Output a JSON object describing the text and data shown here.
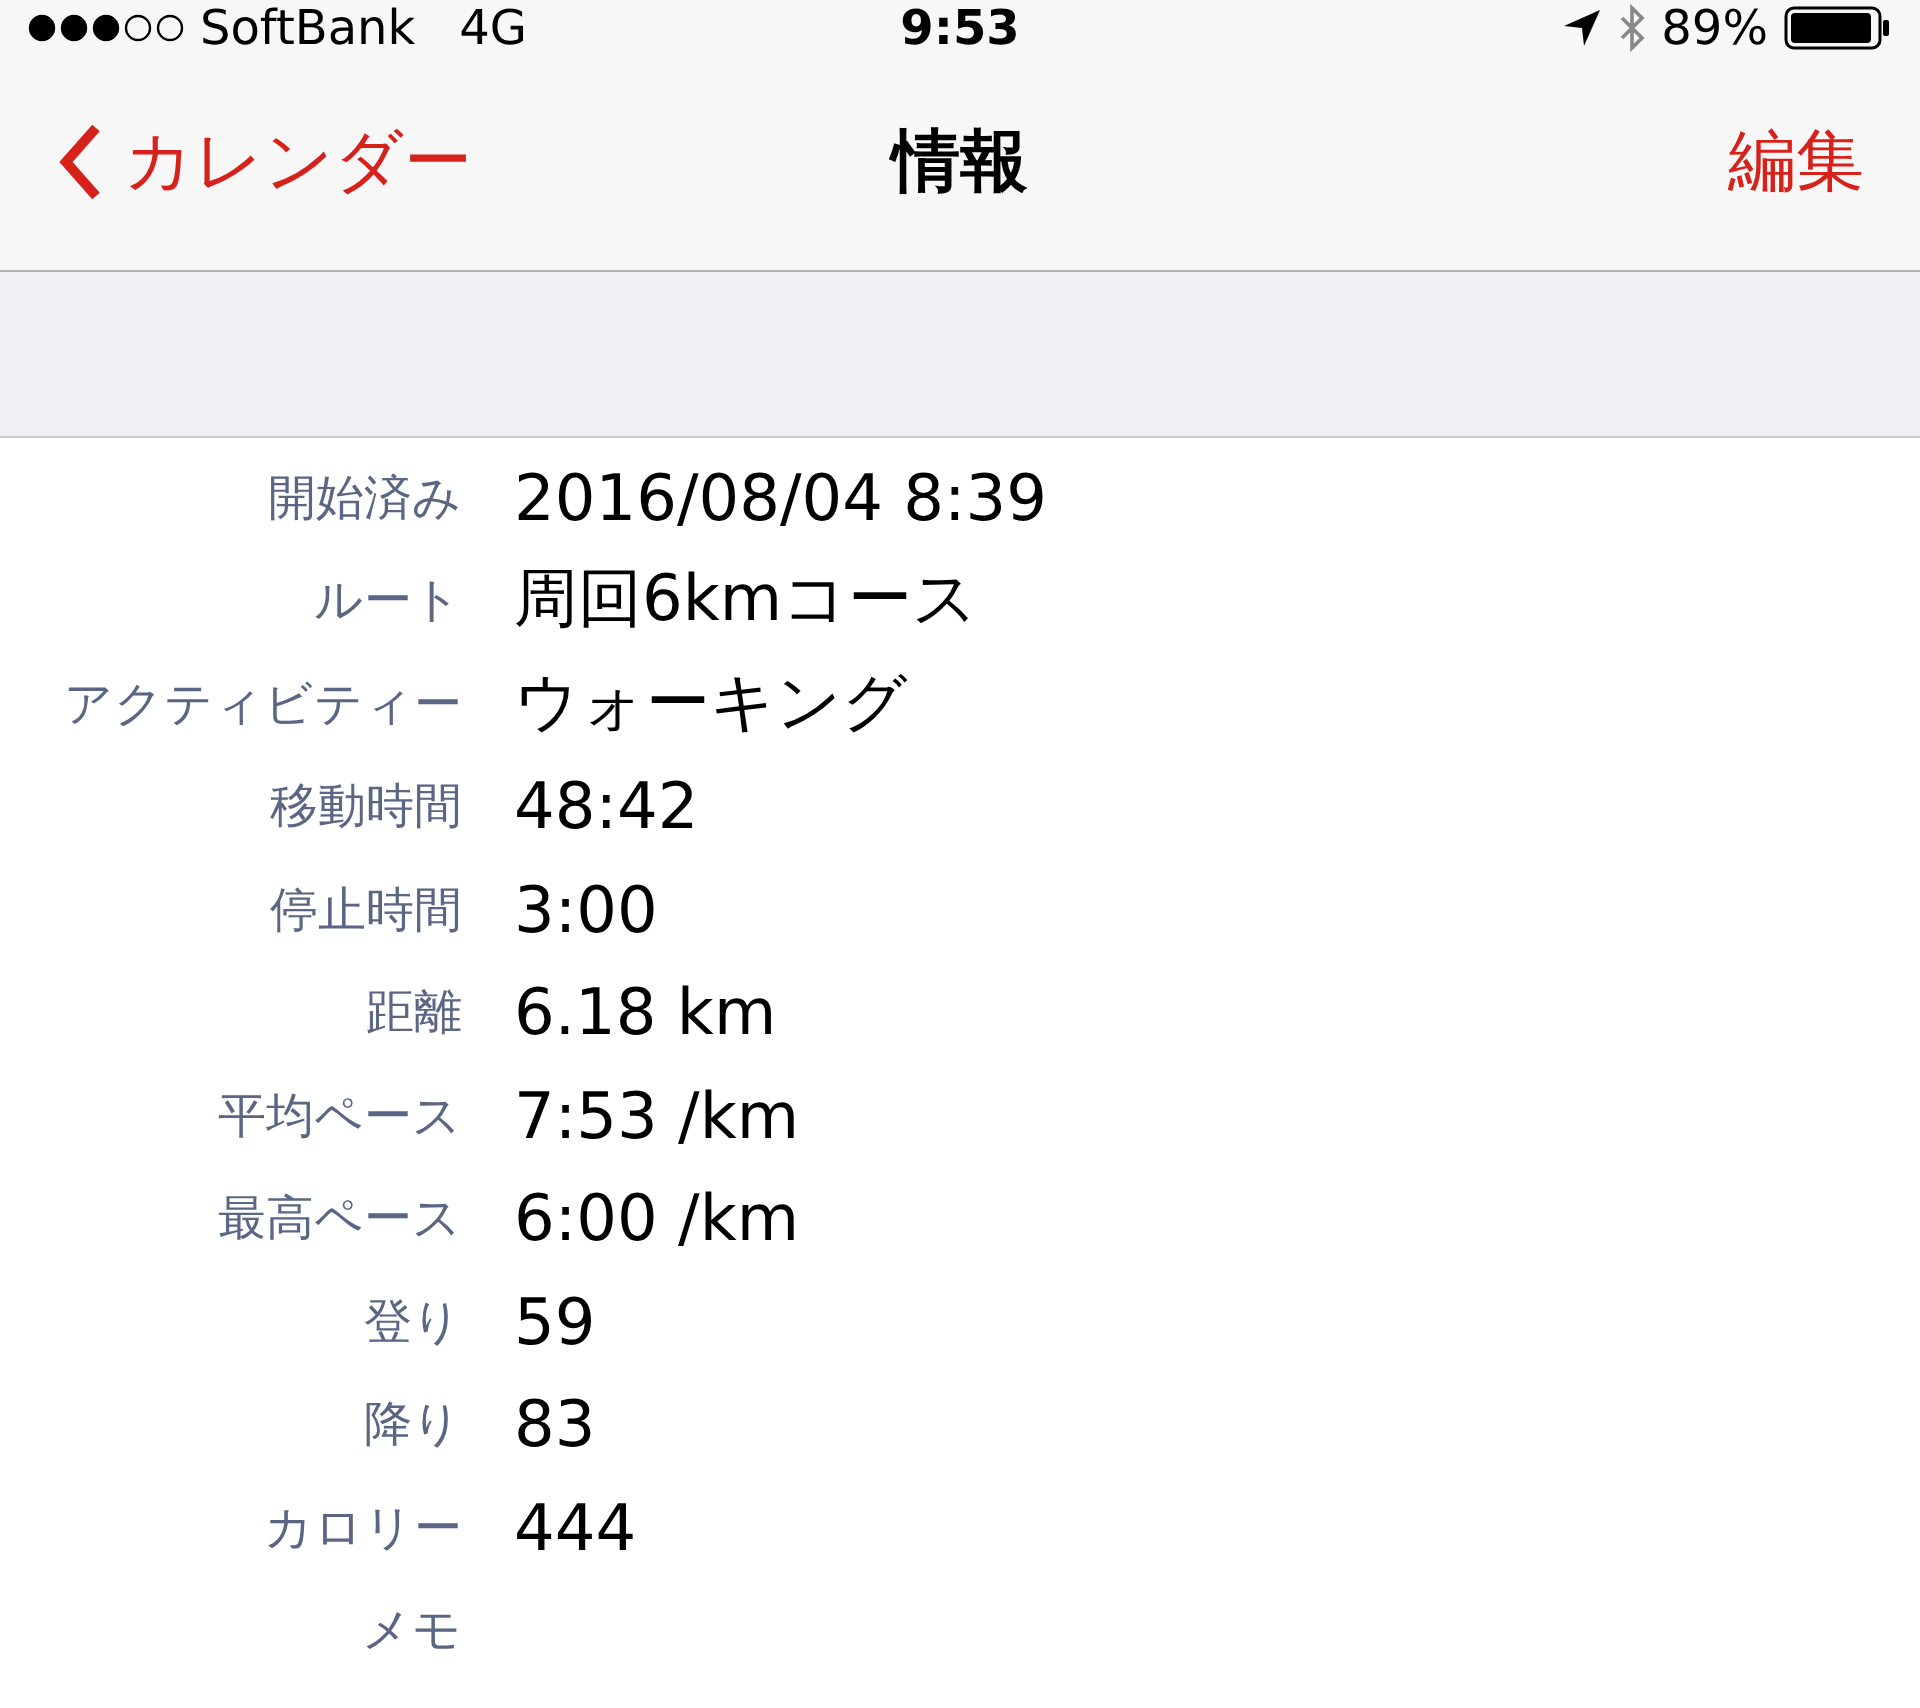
{
  "status_bar": {
    "carrier": "SoftBank",
    "network": "4G",
    "time": "9:53",
    "battery": "89%"
  },
  "nav_bar": {
    "back_label": "カレンダー",
    "title": "情報",
    "action": "編集"
  },
  "rows": [
    {
      "label": "開始済み",
      "value": "2016/08/04 8:39"
    },
    {
      "label": "ルート",
      "value": "周回6kmコース"
    },
    {
      "label": "アクティビティー",
      "value": "ウォーキング"
    },
    {
      "label": "移動時間",
      "value": "48:42"
    },
    {
      "label": "停止時間",
      "value": "3:00"
    },
    {
      "label": "距離",
      "value": "6.18 km"
    },
    {
      "label": "平均ペース",
      "value": "7:53 /km"
    },
    {
      "label": "最高ペース",
      "value": "6:00 /km"
    },
    {
      "label": "登り",
      "value": "59"
    },
    {
      "label": "降り",
      "value": "83"
    },
    {
      "label": "カロリー",
      "value": "444"
    },
    {
      "label": "メモ"
    }
  ]
}
